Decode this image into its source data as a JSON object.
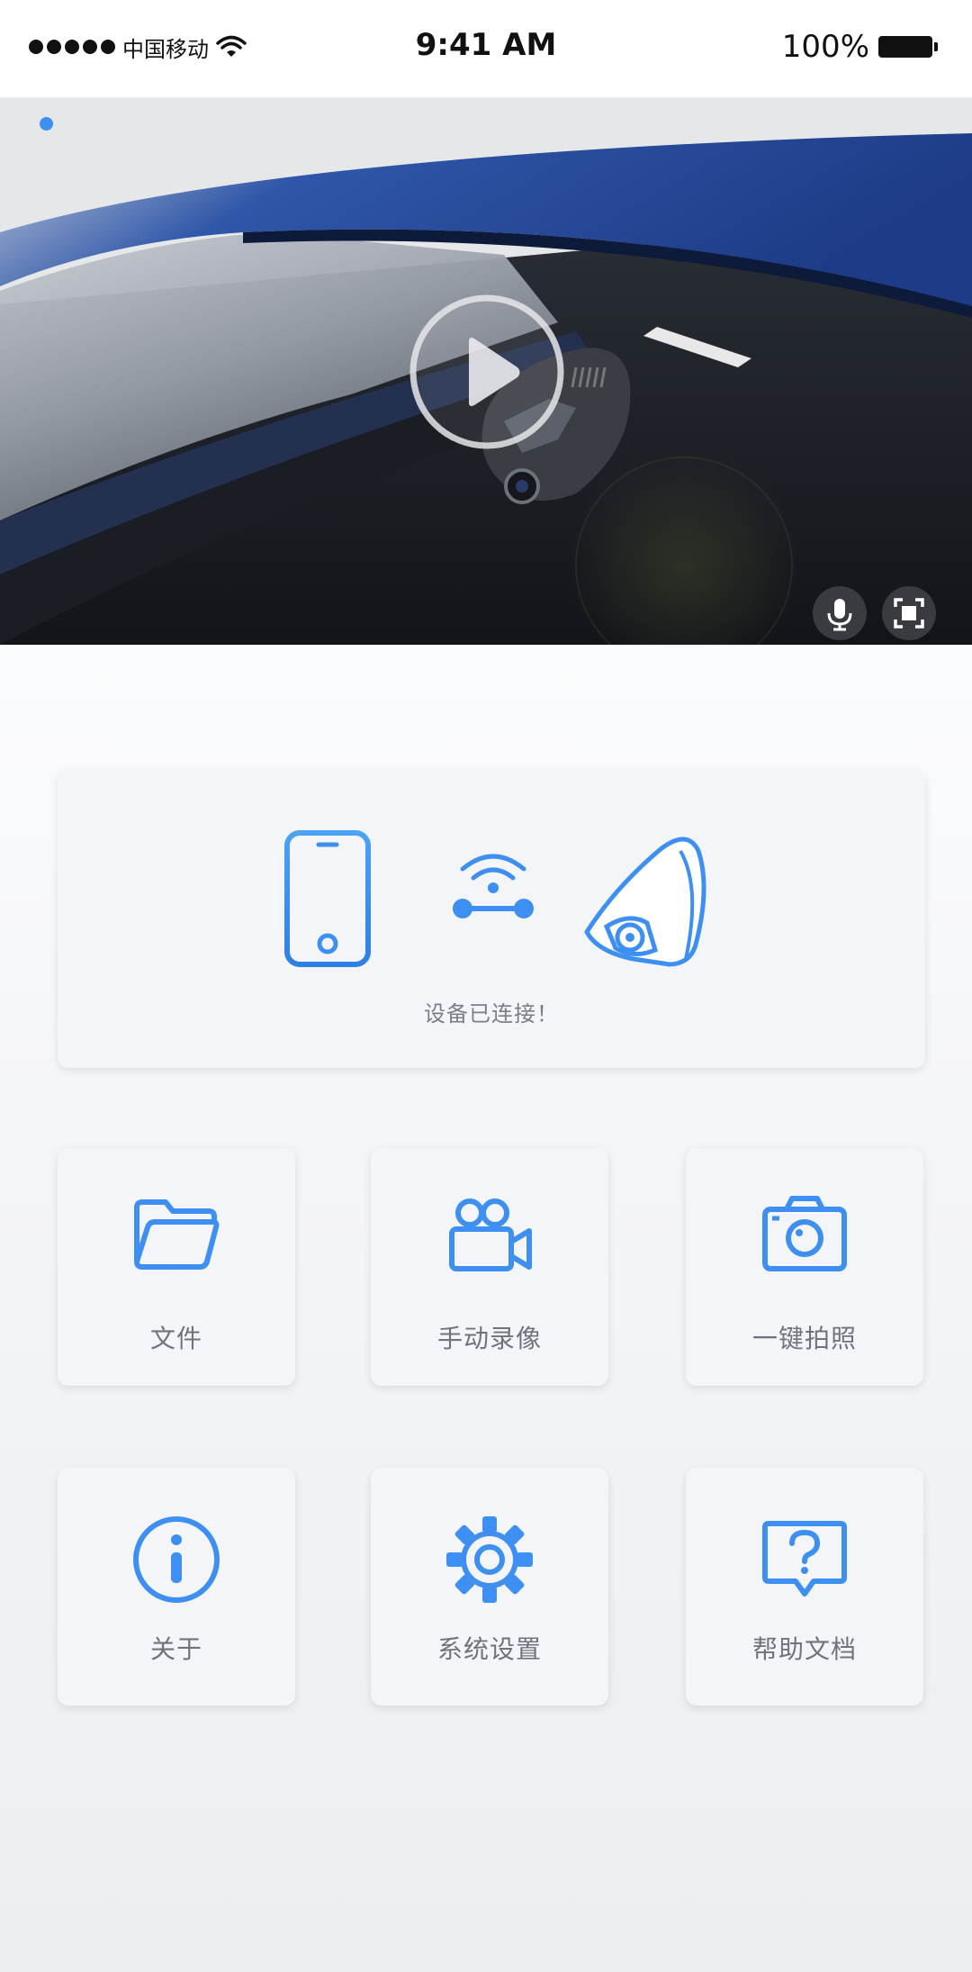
{
  "status_bar": {
    "carrier": "中国移动",
    "time": "9:41 AM",
    "battery_percent": "100%"
  },
  "video": {
    "play_icon": "play-circle-icon",
    "mic_icon": "microphone-icon",
    "fullscreen_icon": "fullscreen-icon"
  },
  "connection": {
    "status": "设备已连接！",
    "phone_icon": "phone-icon",
    "wifi_icon": "wifi-link-icon",
    "device_icon": "dashcam-icon"
  },
  "menu": [
    {
      "label": "文件",
      "icon": "folder-icon"
    },
    {
      "label": "手动录像",
      "icon": "video-camera-icon"
    },
    {
      "label": "一键拍照",
      "icon": "camera-icon"
    },
    {
      "label": "关于",
      "icon": "info-icon"
    },
    {
      "label": "系统设置",
      "icon": "gear-icon"
    },
    {
      "label": "帮助文档",
      "icon": "help-icon"
    }
  ],
  "colors": {
    "accent": "#3d8ff1",
    "label": "#6f737d",
    "card_bg": "#f4f5f8"
  }
}
